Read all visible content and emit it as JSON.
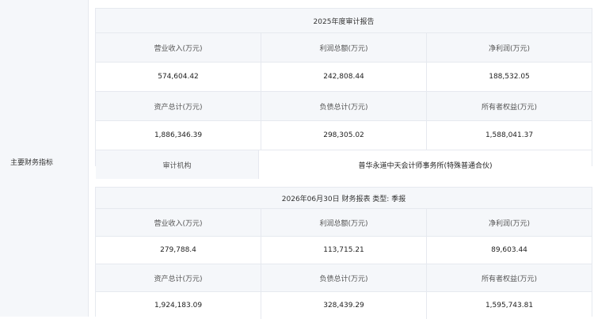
{
  "side_label": "主要财务指标",
  "report_annual": {
    "title": "2025年度审计报告",
    "headers_1": [
      "营业收入(万元)",
      "利润总额(万元)",
      "净利润(万元)"
    ],
    "values_1": [
      "574,604.42",
      "242,808.44",
      "188,532.05"
    ],
    "headers_2": [
      "资产总计(万元)",
      "负债总计(万元)",
      "所有者权益(万元)"
    ],
    "values_2": [
      "1,886,346.39",
      "298,305.02",
      "1,588,041.37"
    ],
    "audit_label": "审计机构",
    "audit_value": "普华永道中天会计师事务所(特殊普通合伙)"
  },
  "report_quarter": {
    "title": "2026年06月30日 财务报表 类型: 季报",
    "headers_1": [
      "营业收入(万元)",
      "利润总额(万元)",
      "净利润(万元)"
    ],
    "values_1": [
      "279,788.4",
      "113,715.21",
      "89,603.44"
    ],
    "headers_2": [
      "资产总计(万元)",
      "负债总计(万元)",
      "所有者权益(万元)"
    ],
    "values_2": [
      "1,924,183.09",
      "328,439.29",
      "1,595,743.81"
    ]
  }
}
